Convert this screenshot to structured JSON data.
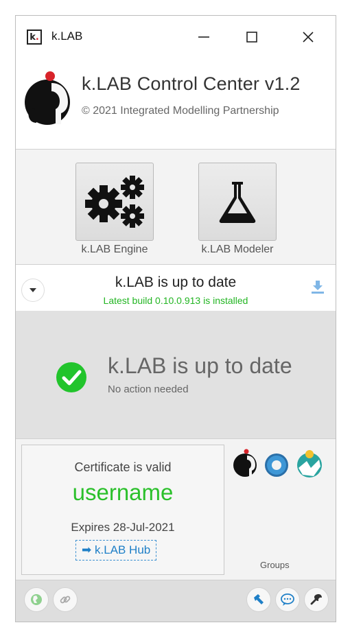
{
  "window": {
    "title": "k.LAB",
    "icon_letter": "k",
    "icon_dot": "."
  },
  "header": {
    "title": "k.LAB Control Center v1.2",
    "copyright": "© 2021 Integrated Modelling Partnership"
  },
  "tools": [
    {
      "label": "k.LAB Engine",
      "icon": "gears-icon"
    },
    {
      "label": "k.LAB Modeler",
      "icon": "flask-icon"
    }
  ],
  "status": {
    "title": "k.LAB is up to date",
    "subtitle": "Latest build 0.10.0.913 is installed"
  },
  "main_status": {
    "title": "k.LAB is up to date",
    "subtitle": "No action needed"
  },
  "certificate": {
    "valid_text": "Certificate is valid",
    "username": "username",
    "expires": "Expires 28-Jul-2021",
    "hub_link": "➡ k.LAB Hub"
  },
  "groups": {
    "label": "Groups"
  },
  "colors": {
    "accent_green": "#2bc02b",
    "status_green": "#22b522",
    "link_blue": "#1e7fc7",
    "brand_red": "#d8232a"
  }
}
